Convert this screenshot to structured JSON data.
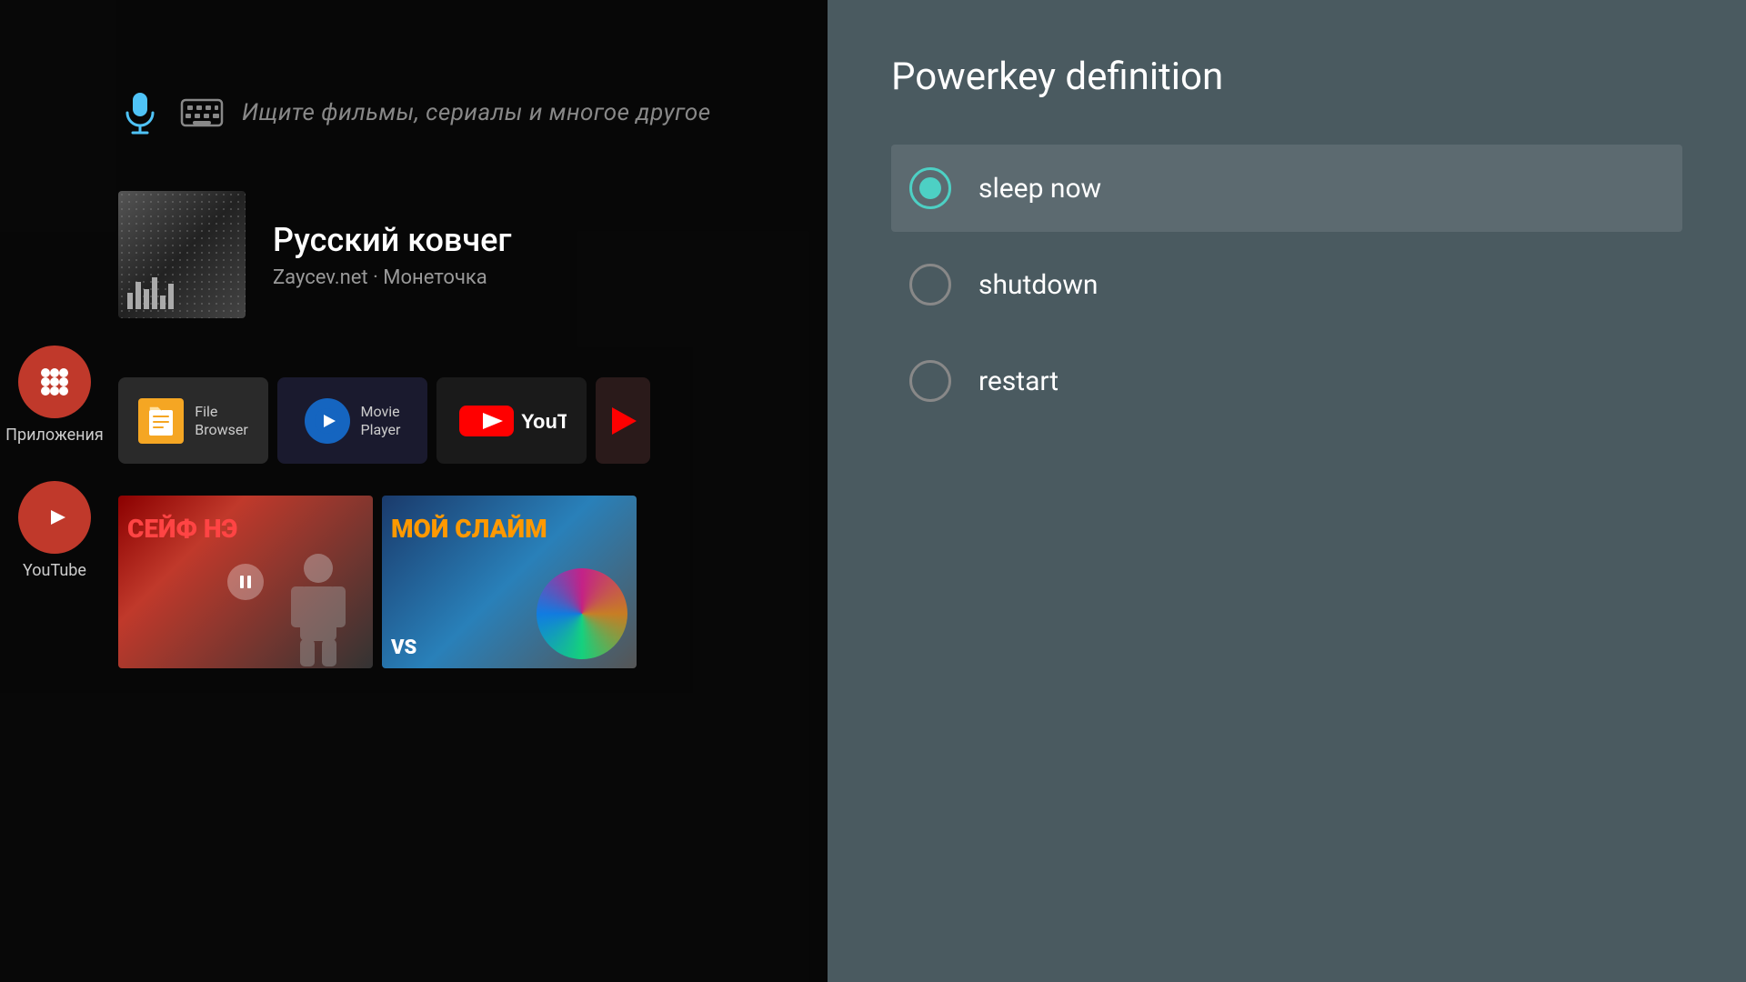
{
  "main": {
    "search_placeholder": "Ищите фильмы, сериалы и многое другое",
    "song_title": "Русский ковчег",
    "song_subtitle": "Zaycev.net · Монеточка",
    "apps": [
      {
        "id": "file-browser",
        "label": "File\nBrowser"
      },
      {
        "id": "movie-player",
        "label": "Movie\nPlayer"
      },
      {
        "id": "youtube",
        "label": "YouTube"
      }
    ],
    "sidebar": [
      {
        "id": "apps",
        "label": "Приложения"
      },
      {
        "id": "youtube",
        "label": "YouTube"
      }
    ]
  },
  "powerkey": {
    "title": "Powerkey definition",
    "options": [
      {
        "id": "sleep-now",
        "label": "sleep now",
        "selected": true
      },
      {
        "id": "shutdown",
        "label": "shutdown",
        "selected": false
      },
      {
        "id": "restart",
        "label": "restart",
        "selected": false
      }
    ]
  }
}
